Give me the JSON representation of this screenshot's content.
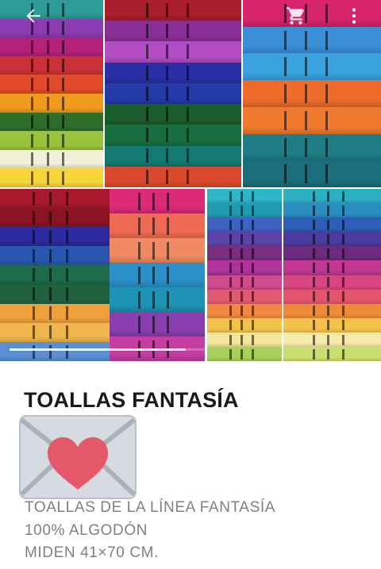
{
  "toolbar": {
    "back_icon": "arrow-left-icon",
    "cart_icon": "shopping-cart-icon",
    "menu_icon": "more-vertical-icon"
  },
  "gallery": {
    "photos": [
      {
        "name": "photo-towels-1",
        "colors": [
          "#2e9b97",
          "#8c3bb0",
          "#b3227a",
          "#c93137",
          "#e24b2a",
          "#f39a1e",
          "#2f6e2a",
          "#9ac23d",
          "#f2f0d8",
          "#f6d63b"
        ]
      },
      {
        "name": "photo-towels-2",
        "colors": [
          "#a81e2b",
          "#8a2f96",
          "#b04dc2",
          "#2a2fa6",
          "#233aa8",
          "#1b5e2c",
          "#176e3f",
          "#127a73",
          "#d94a2c"
        ]
      },
      {
        "name": "photo-towels-3",
        "colors": [
          "#d8236d",
          "#3a8fd9",
          "#3aa2e0",
          "#ee6b2a",
          "#f07a2e",
          "#1f7d86",
          "#1b6f7c"
        ]
      },
      {
        "name": "photo-towels-4",
        "colors": [
          "#a9192c",
          "#8b1424",
          "#2b2a9e",
          "#2a55b0",
          "#1d6b4a",
          "#21623e",
          "#f0a03b",
          "#f0b64d",
          "#5a8fd4"
        ]
      },
      {
        "name": "photo-towels-5",
        "colors": [
          "#dd2a78",
          "#ef6a52",
          "#f08a62",
          "#2b8fc8",
          "#1e93b5",
          "#8a3fb0",
          "#c53da0"
        ]
      },
      {
        "name": "photo-towels-6",
        "colors": [
          "#2fb6c8",
          "#1f9bb0",
          "#3d62c2",
          "#5b44a8",
          "#7a2e7e",
          "#b0359a",
          "#d14a8c",
          "#e25a6e",
          "#f0883f",
          "#f2c34a",
          "#f3e59a",
          "#a8d05a"
        ]
      },
      {
        "name": "photo-towels-7",
        "colors": [
          "#2ab0c2",
          "#2a8fbf",
          "#2d5fb8",
          "#4a3c9e",
          "#6c2b7d",
          "#c23890",
          "#d9457e",
          "#e3556a",
          "#ef8b38",
          "#f4c24a",
          "#f5eaa8",
          "#c9df6e"
        ]
      }
    ],
    "scroll_progress": 0.9
  },
  "product": {
    "title": "TOALLAS FANTASÍA",
    "hidden_suffix": "0",
    "description_lines": [
      "TOALLAS DE LA LÍNEA FANTASÍA",
      "100% ALGODÓN",
      "MIDEN 41×70 CM."
    ],
    "sticker_icon": "heart-envelope-icon"
  }
}
